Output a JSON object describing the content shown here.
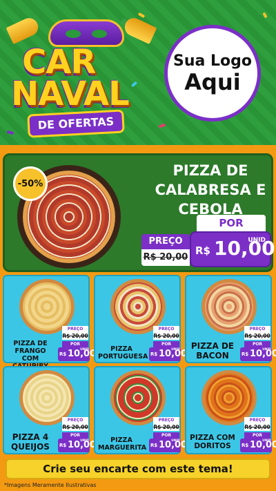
{
  "header": {
    "title_top": "CAR",
    "title_bottom": "NAVAL",
    "subtitle": "DE OFERTAS",
    "logo_line1": "Sua Logo",
    "logo_line2": "Aqui"
  },
  "featured": {
    "discount": "-50%",
    "name": "PIZZA DE CALABRESA E CEBOLA",
    "preco_label": "PREÇO",
    "por_label": "POR",
    "old_price": "R$ 20,00",
    "new_price_currency": "R$",
    "new_price_value": "10,00",
    "unit": "UNID"
  },
  "items": [
    {
      "name": "PIZZA DE FRANGO COM CATUPIRY",
      "preco": "PREÇO",
      "old": "R$ 20,00",
      "por": "POR",
      "currency": "R$",
      "value": "10,00",
      "unit": "UNID"
    },
    {
      "name": "PIZZA PORTUGUESA",
      "preco": "PREÇO",
      "old": "R$ 20,00",
      "por": "POR",
      "currency": "R$",
      "value": "10,00",
      "unit": "UNID"
    },
    {
      "name": "PIZZA DE BACON",
      "preco": "PREÇO",
      "old": "R$ 20,00",
      "por": "POR",
      "currency": "R$",
      "value": "10,00",
      "unit": "UNID"
    },
    {
      "name": "PIZZA 4 QUEIJOS",
      "preco": "PREÇO",
      "old": "R$ 20,00",
      "por": "POR",
      "currency": "R$",
      "value": "10,00",
      "unit": "UNID"
    },
    {
      "name": "PIZZA MARGUERITA",
      "preco": "PREÇO",
      "old": "R$ 20,00",
      "por": "POR",
      "currency": "R$",
      "value": "10,00",
      "unit": "UNID"
    },
    {
      "name": "PIZZA COM DORITOS",
      "preco": "PREÇO",
      "old": "R$ 20,00",
      "por": "POR",
      "currency": "R$",
      "value": "10,00",
      "unit": "UNID"
    }
  ],
  "footer": {
    "cta": "Crie seu encarte com este tema!",
    "disclaimer": "*Imagens Meramente Ilustrativas"
  },
  "colors": {
    "purple": "#7b2fc7",
    "green": "#2a9a3a",
    "cyan": "#3cc6e6",
    "orange": "#f39a12",
    "yellow": "#f6d22a"
  }
}
